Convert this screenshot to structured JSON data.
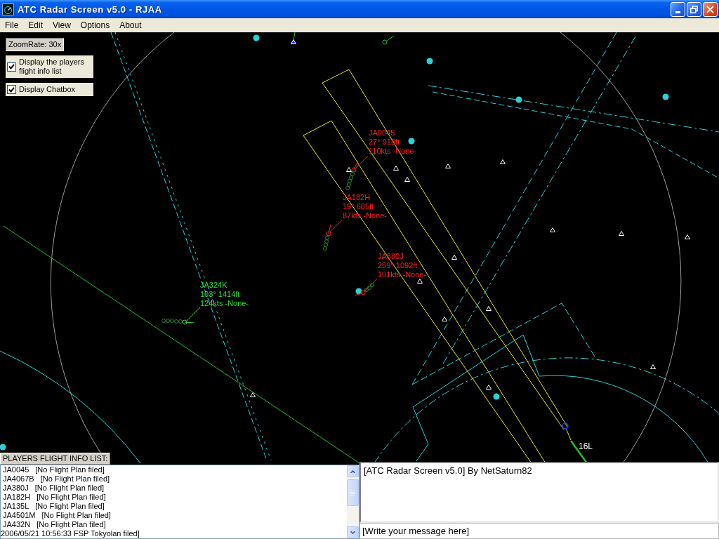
{
  "window": {
    "title": "ATC Radar Screen v5.0 - RJAA"
  },
  "menu": [
    {
      "label": "File"
    },
    {
      "label": "Edit"
    },
    {
      "label": "View"
    },
    {
      "label": "Options"
    },
    {
      "label": "About"
    }
  ],
  "radar": {
    "zoom_rate": "ZoomRate: 30x",
    "toggles": [
      {
        "label": "Display the players flight info list",
        "checked": true
      },
      {
        "label": "Display Chatbox",
        "checked": true
      }
    ],
    "aircraft": [
      {
        "callsign": "JA0045",
        "heading_altitude": "27° 918ft",
        "speed_plan": "110kts -None-",
        "color": "#ff2020"
      },
      {
        "callsign": "JA182H",
        "heading_altitude": "19° 685ft",
        "speed_plan": "87kts -None-",
        "color": "#ff2020"
      },
      {
        "callsign": "JA380J",
        "heading_altitude": "259° 1092ft",
        "speed_plan": "101kts -None-",
        "color": "#ff2020"
      },
      {
        "callsign": "JA324K",
        "heading_altitude": "103° 1414ft",
        "speed_plan": "124kts -None-",
        "color": "#33dd33"
      }
    ],
    "runway_label": "16L"
  },
  "flight_list": {
    "title": "PLAYERS FLIGHT INFO LIST:",
    "rows": [
      {
        "callsign": "JA0045",
        "flight_plan": "[No Flight Plan filed]"
      },
      {
        "callsign": "JA4067B",
        "flight_plan": "[No Flight Plan filed]"
      },
      {
        "callsign": "JA380J",
        "flight_plan": "[No Flight Plan filed]"
      },
      {
        "callsign": "JA182H",
        "flight_plan": "[No Flight Plan filed]"
      },
      {
        "callsign": "JA135L",
        "flight_plan": "[No Flight Plan filed]"
      },
      {
        "callsign": "JA4501M",
        "flight_plan": "[No Flight Plan filed]"
      },
      {
        "callsign": "JA432N",
        "flight_plan": "[No Flight Plan filed]"
      }
    ],
    "log_line": "2006/05/21 10:56:33 FSP Tokyolan filed]"
  },
  "chat": {
    "messages": [
      "[ATC Radar Screen v5.0] By NetSaturn82"
    ],
    "input": {
      "value": "[Write your message here]"
    }
  }
}
